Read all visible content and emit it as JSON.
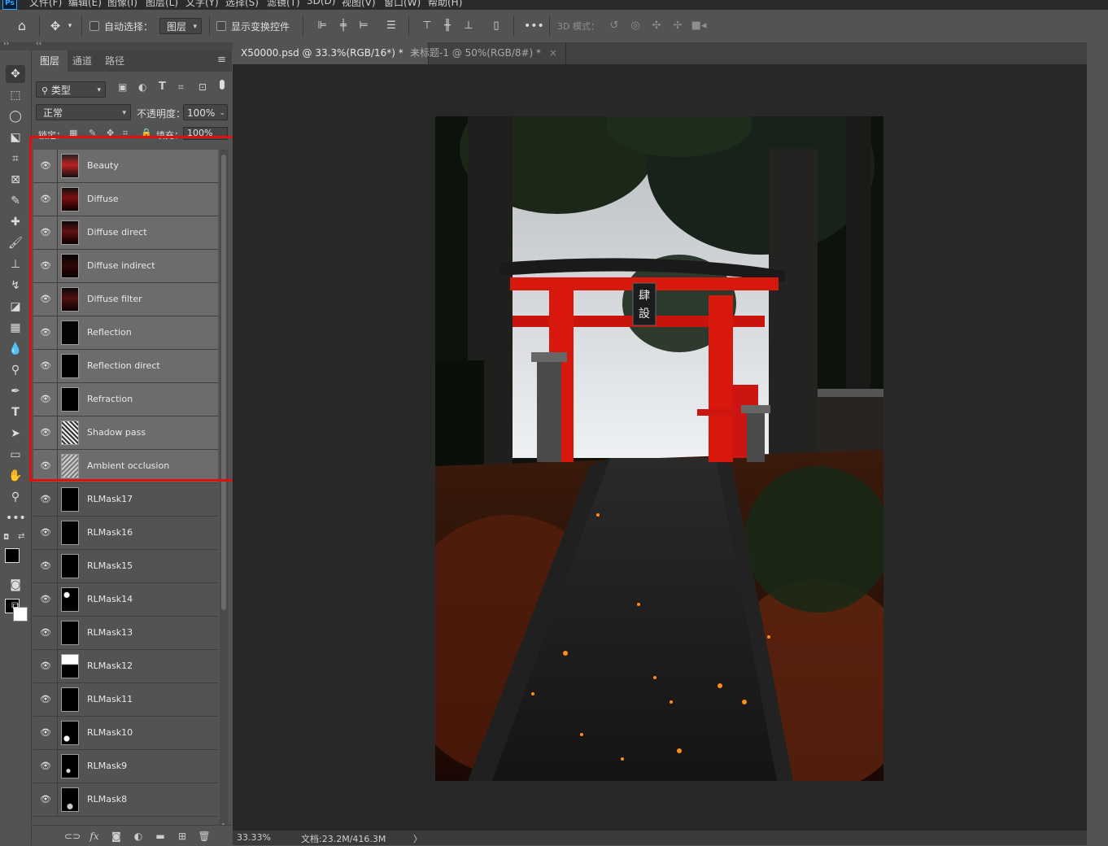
{
  "menu": {
    "app_badge": "Ps",
    "items": [
      "文件(F)",
      "编辑(E)",
      "图像(I)",
      "图层(L)",
      "文字(Y)",
      "选择(S)",
      "滤镜(T)",
      "3D(D)",
      "视图(V)",
      "窗口(W)",
      "帮助(H)"
    ]
  },
  "options_bar": {
    "auto_select_label": "自动选择：",
    "auto_select_value": "图层",
    "show_transform_label": "显示变换控件",
    "mode_3d_label": "3D 模式："
  },
  "panel": {
    "tabs": [
      "图层",
      "通道",
      "路径"
    ],
    "filter_kind": "类型",
    "blend_mode": "正常",
    "opacity_label": "不透明度：",
    "opacity_value": "100%",
    "lock_label": "锁定：",
    "fill_label": "填充：",
    "fill_value": "100%"
  },
  "layers": [
    {
      "name": "Beauty",
      "highlighted": true
    },
    {
      "name": "Diffuse",
      "highlighted": true
    },
    {
      "name": "Diffuse direct",
      "highlighted": true
    },
    {
      "name": "Diffuse indirect",
      "highlighted": true
    },
    {
      "name": "Diffuse filter",
      "highlighted": true
    },
    {
      "name": "Reflection",
      "highlighted": true
    },
    {
      "name": "Reflection direct",
      "highlighted": true
    },
    {
      "name": "Refraction",
      "highlighted": true
    },
    {
      "name": "Shadow pass",
      "highlighted": true
    },
    {
      "name": "Ambient occlusion",
      "highlighted": true
    },
    {
      "name": "RLMask17",
      "highlighted": false
    },
    {
      "name": "RLMask16",
      "highlighted": false
    },
    {
      "name": "RLMask15",
      "highlighted": false
    },
    {
      "name": "RLMask14",
      "highlighted": false
    },
    {
      "name": "RLMask13",
      "highlighted": false
    },
    {
      "name": "RLMask12",
      "highlighted": false
    },
    {
      "name": "RLMask11",
      "highlighted": false
    },
    {
      "name": "RLMask10",
      "highlighted": false
    },
    {
      "name": "RLMask9",
      "highlighted": false
    },
    {
      "name": "RLMask8",
      "highlighted": false
    }
  ],
  "doc_tabs": [
    {
      "label": "X50000.psd @ 33.3%(RGB/16*) *",
      "active": true
    },
    {
      "label": "未标题-1 @ 50%(RGB/8#) *",
      "active": false
    }
  ],
  "torii_sign": "肆設",
  "status": {
    "zoom": "33.33%",
    "doc_info": "文档:23.2M/416.3M",
    "arrow": "〉"
  },
  "colors": {
    "highlight_box": "#e01010",
    "torii_red": "#d8180c"
  }
}
